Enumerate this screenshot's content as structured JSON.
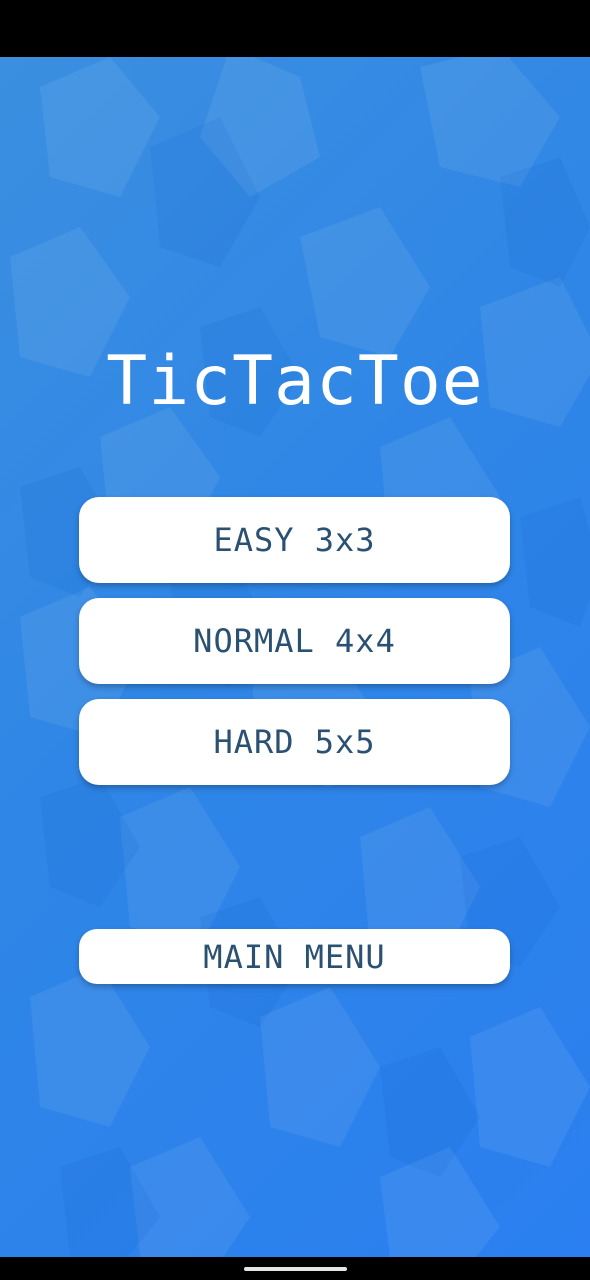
{
  "app": {
    "title": "TicTacToe",
    "background_colors": [
      "#3b8fe0",
      "#2f86e6",
      "#2b7ff0"
    ],
    "button_text_color": "#2b5172"
  },
  "menu": {
    "easy_label": "EASY 3x3",
    "normal_label": "NORMAL 4x4",
    "hard_label": "HARD 5x5",
    "main_menu_label": "MAIN MENU"
  }
}
